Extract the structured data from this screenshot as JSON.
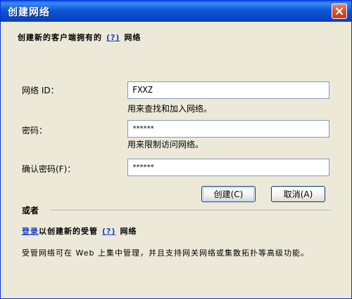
{
  "window": {
    "title": "创建网络"
  },
  "intro": {
    "text_before": "创建新的客户端拥有的",
    "help_link": "(?)",
    "text_after": "网络"
  },
  "form": {
    "network_id": {
      "label": "网络 ID：",
      "value": "FXXZ",
      "hint": "用来查找和加入网络。"
    },
    "password": {
      "label": "密码：",
      "value": "******",
      "hint": "用来限制访问网络。"
    },
    "confirm_password": {
      "label": "确认密码(F)：",
      "value": "******"
    }
  },
  "buttons": {
    "create": "创建(C)",
    "cancel": "取消(A)"
  },
  "or_section": {
    "title": "或者",
    "login_link": "登录",
    "text_middle": "以创建新的受管",
    "help_link": "(?)",
    "text_after": "网络",
    "description": "受管网络可在 Web 上集中管理，并且支持网关网络或集散拓扑等高级功能。"
  },
  "icons": {
    "close": "close-icon"
  },
  "colors": {
    "titlebar": "#0846c7",
    "dialog_bg": "#ece9d8",
    "link": "#1a3fc8",
    "close_button": "#d5502e"
  }
}
